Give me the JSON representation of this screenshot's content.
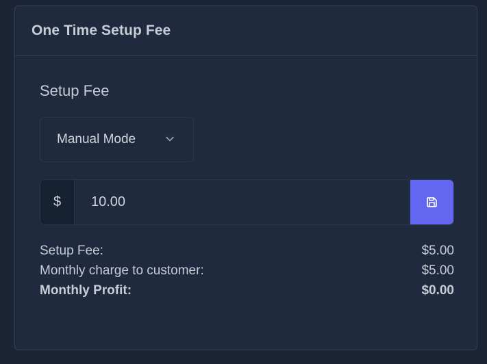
{
  "card": {
    "title": "One Time Setup Fee"
  },
  "setup_fee": {
    "section_title": "Setup Fee",
    "mode_select": {
      "selected": "Manual Mode",
      "icon": "chevron-down-icon"
    },
    "amount": {
      "prefix": "$",
      "value": "10.00"
    },
    "save_icon": "floppy-disk-icon"
  },
  "summary": {
    "rows": [
      {
        "label": "Setup Fee:",
        "value": "$5.00"
      },
      {
        "label": "Monthly charge to customer:",
        "value": "$5.00"
      },
      {
        "label": "Monthly Profit:",
        "value": "$0.00"
      }
    ]
  },
  "colors": {
    "page_bg": "#1c2536",
    "card_bg": "#1f2a3e",
    "border": "#334155",
    "accent": "#6366f1",
    "text": "#c7cdd7"
  }
}
